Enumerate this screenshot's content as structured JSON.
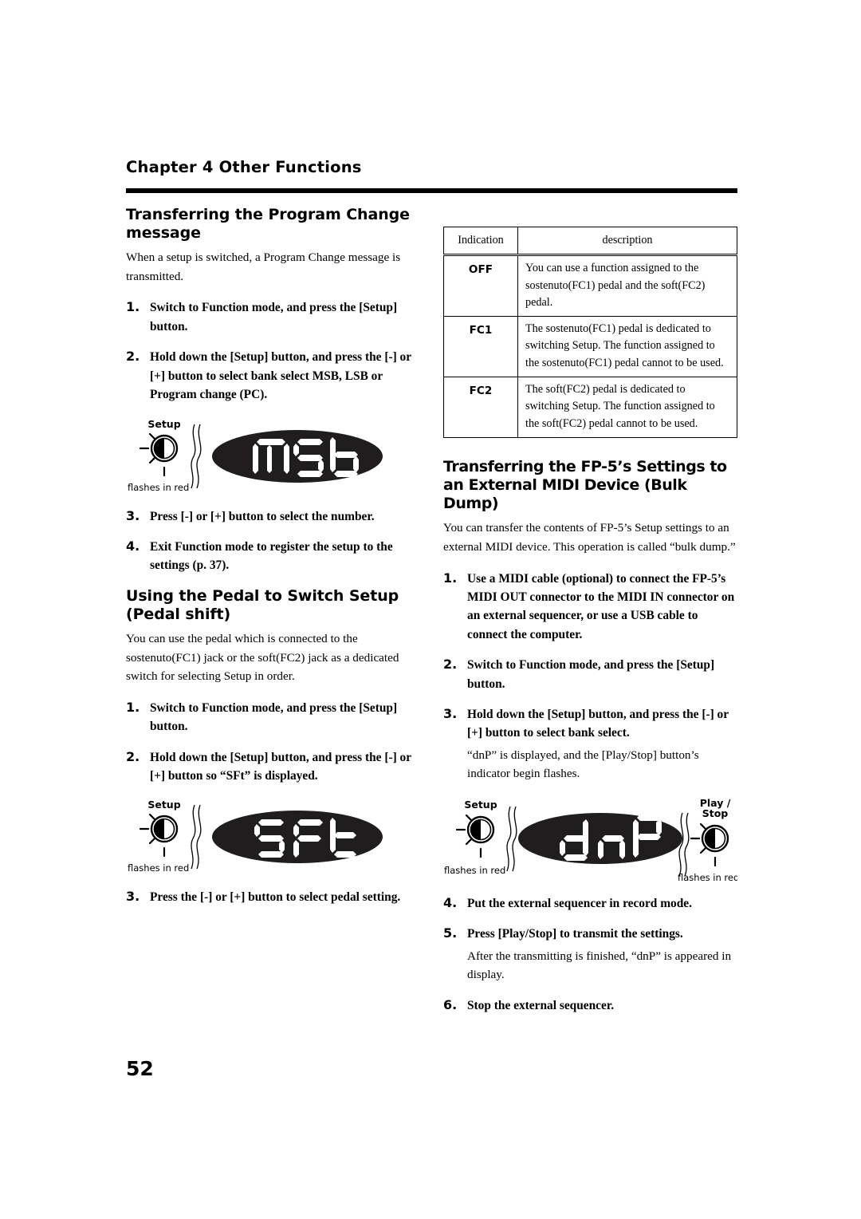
{
  "page": {
    "chapter_title": "Chapter 4 Other Functions",
    "page_number": "52"
  },
  "left_column": {
    "section1": {
      "heading": "Transferring the Program Change message",
      "intro": "When a setup is switched, a Program Change message is transmitted.",
      "steps": [
        {
          "num": "1.",
          "text": "Switch to Function mode, and press the [Setup] button."
        },
        {
          "num": "2.",
          "text": "Hold down the [Setup] button, and press the [-] or [+] button to select bank select MSB, LSB or Program change (PC)."
        },
        {
          "num": "3.",
          "text": "Press [-] or [+] button to select the number."
        },
        {
          "num": "4.",
          "text": "Exit Function mode to register the setup to the settings (p. 37)."
        }
      ],
      "figure": {
        "knob_label": "Setup",
        "knob_caption": "flashes in red",
        "display_text": "MSb"
      }
    },
    "section2": {
      "heading": "Using the Pedal to Switch Setup (Pedal shift)",
      "intro": "You can use the pedal which is connected to the sostenuto(FC1) jack or the soft(FC2) jack as a dedicated switch for selecting Setup in order.",
      "steps": [
        {
          "num": "1.",
          "text": "Switch to Function mode, and press the [Setup] button."
        },
        {
          "num": "2.",
          "text": "Hold down the [Setup] button, and press the [-] or [+] button so “SFt” is displayed."
        },
        {
          "num": "3.",
          "text": "Press the [-] or [+] button to select pedal setting."
        }
      ],
      "figure": {
        "knob_label": "Setup",
        "knob_caption": "flashes in red",
        "display_text": "SFt"
      }
    }
  },
  "right_column": {
    "table": {
      "headers": [
        "Indication",
        "description"
      ],
      "rows": [
        {
          "indication": "OFF",
          "description": "You can use a function assigned to the sostenuto(FC1) pedal and the soft(FC2) pedal."
        },
        {
          "indication": "FC1",
          "description": "The sostenuto(FC1) pedal is dedicated to switching Setup. The function assigned to the sostenuto(FC1) pedal cannot to be used."
        },
        {
          "indication": "FC2",
          "description": "The soft(FC2) pedal is dedicated to switching Setup. The function assigned to the soft(FC2) pedal cannot to be used."
        }
      ]
    },
    "section": {
      "heading": "Transferring the FP-5’s Settings to an External MIDI Device (Bulk Dump)",
      "intro": "You can transfer the contents of FP-5’s Setup settings to an external MIDI device. This operation is called “bulk dump.”",
      "steps": [
        {
          "num": "1.",
          "text": "Use a MIDI cable (optional) to connect the FP-5’s MIDI OUT connector to the MIDI IN connector on an external sequencer, or use a USB cable to connect the computer."
        },
        {
          "num": "2.",
          "text": "Switch to Function mode, and press the [Setup] button."
        },
        {
          "num": "3.",
          "text": "Hold down the [Setup] button, and press the [-] or [+] button to select bank select.",
          "sub": "“dnP” is displayed, and the [Play/Stop] button’s indicator begin flashes."
        },
        {
          "num": "4.",
          "text": "Put the external sequencer in record mode."
        },
        {
          "num": "5.",
          "text": "Press [Play/Stop] to transmit the settings.",
          "sub": "After the transmitting is finished, “dnP” is appeared in display."
        },
        {
          "num": "6.",
          "text": "Stop the external sequencer."
        }
      ],
      "figure": {
        "left_knob_label": "Setup",
        "left_knob_caption": "flashes in red",
        "display_text": "dnP",
        "right_knob_label_line1": "Play /",
        "right_knob_label_line2": "Stop",
        "right_knob_caption": "flashes in red"
      }
    }
  },
  "colors": {
    "text": "#000000",
    "page_background": "#ffffff",
    "led_display_background": "#201d1e",
    "led_segment": "#ffffff",
    "rule": "#000000"
  }
}
